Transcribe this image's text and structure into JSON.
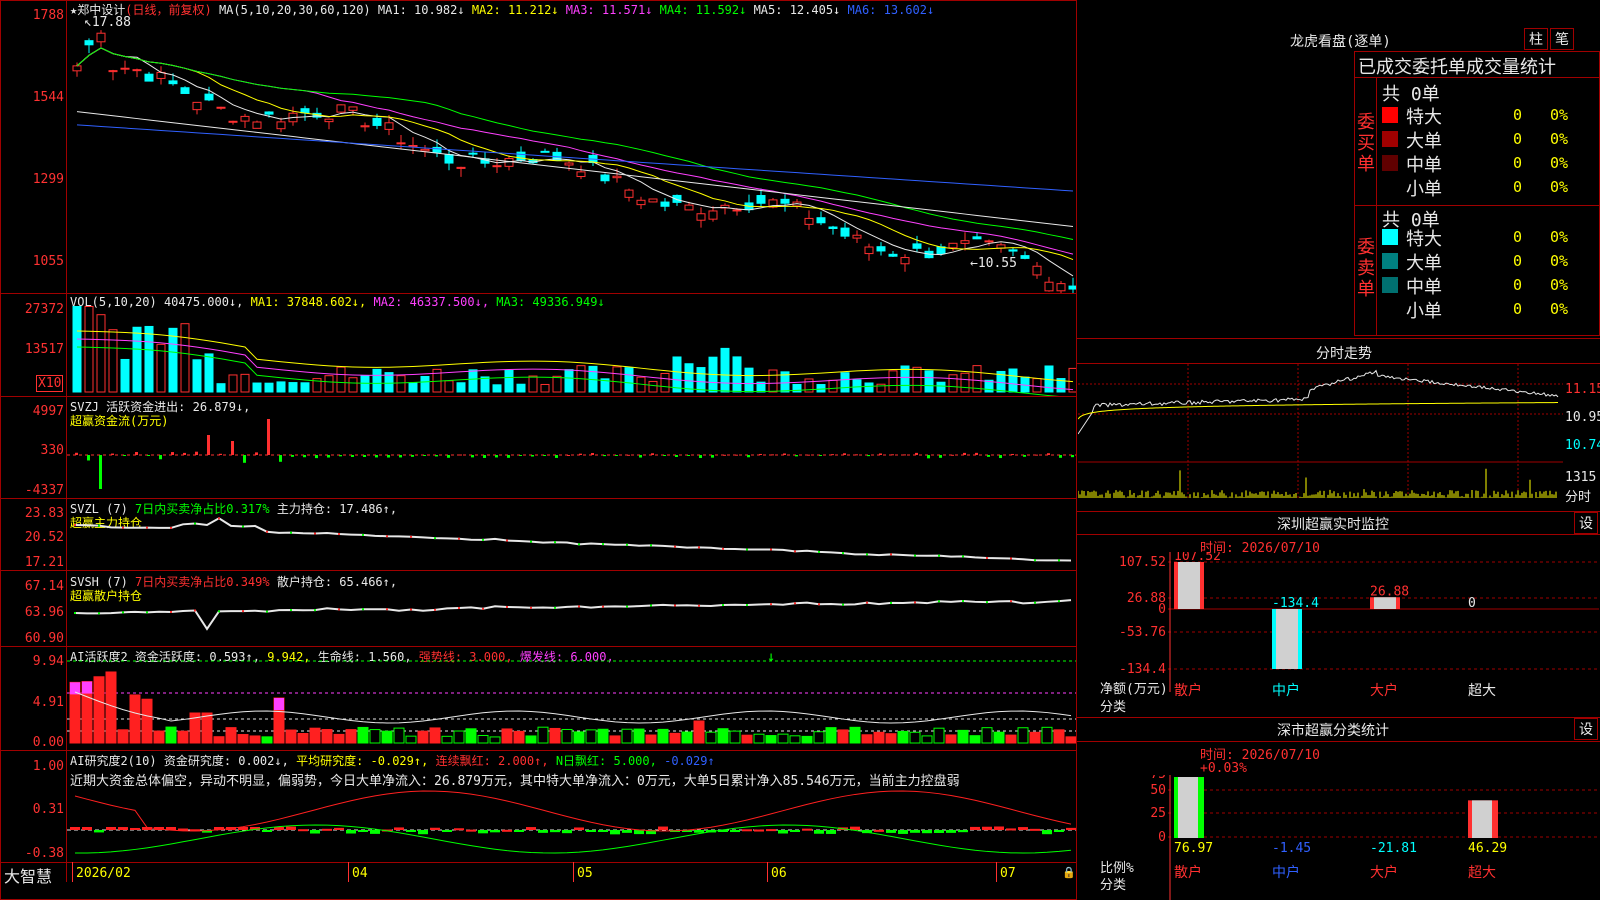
{
  "stock": {
    "name": "郑中设计",
    "mode": "(日线，前复权)",
    "ma_line": "MA(5,10,20,30,60,120)",
    "ma": [
      {
        "label": "MA1:",
        "value": "10.982↓",
        "color": "#e8e8e8"
      },
      {
        "label": "MA2:",
        "value": "11.212↓",
        "color": "#ffff00"
      },
      {
        "label": "MA3:",
        "value": "11.571↓",
        "color": "#ff40ff"
      },
      {
        "label": "MA4:",
        "value": "11.592↓",
        "color": "#00ff00"
      },
      {
        "label": "MA5:",
        "value": "12.405↓",
        "color": "#e8e8e8"
      },
      {
        "label": "MA6:",
        "value": "13.602↓",
        "color": "#3060ff"
      }
    ],
    "high_mark": "17.88",
    "low_mark": "←10.55",
    "price_ticks": [
      "1788",
      "1544",
      "1299",
      "1055"
    ]
  },
  "vol": {
    "label": "VOL(5,10,20)",
    "value": "40475.000↓,",
    "ma": [
      {
        "label": "MA1:",
        "value": "37848.602↓,",
        "color": "#ffff00"
      },
      {
        "label": "MA2:",
        "value": "46337.500↓,",
        "color": "#ff40ff"
      },
      {
        "label": "MA3:",
        "value": "49336.949↓",
        "color": "#00ff00"
      }
    ],
    "ticks": [
      "27372",
      "13517"
    ],
    "unit": "X10"
  },
  "svzj": {
    "label": "SVZJ",
    "title": "活跃资金进出:",
    "value": "26.879↓,",
    "subtitle": "超赢资金流(万元)",
    "ticks": [
      "4997",
      "330",
      "-4337"
    ]
  },
  "svzl": {
    "label": "SVZL (7)",
    "title": "7日内买卖净占比0.317%",
    "hold": "主力持仓: 17.486↑,",
    "subtitle": "超赢主力持仓",
    "ticks": [
      "23.83",
      "20.52",
      "17.21"
    ]
  },
  "svsh": {
    "label": "SVSH (7)",
    "title": "7日内买卖净占比0.349%",
    "hold": "散户持仓: 65.466↑,",
    "subtitle": "超赢散户持仓",
    "ticks": [
      "67.14",
      "63.96",
      "60.90"
    ]
  },
  "ai1": {
    "label": "AI活跃度2",
    "a": "资金活跃度: 0.593↑,",
    "b": "9.942,",
    "c": "生命线: 1.560,",
    "d": "强势线: 3.000,",
    "e": "爆发线: 6.000,",
    "ticks": [
      "9.94",
      "4.91",
      "0.00"
    ]
  },
  "ai2": {
    "label": "AI研究度2(10)",
    "a": "资金研究度: 0.002↓,",
    "b": "平均研究度: -0.029↑,",
    "c": "连续飘红: 2.000↑,",
    "d": "N日飘红: 5.000,",
    "e": "-0.029↑",
    "summary": "近期大资金总体偏空，异动不明显，偏弱势，今日大单净流入：26.879万元，其中特大单净流入：0万元，大单5日累计净入85.546万元，当前主力控盘弱",
    "ticks": [
      "1.00",
      "0.31",
      "-0.38"
    ]
  },
  "bottom": {
    "brand": "大智慧",
    "dates": [
      "2026/02",
      "04",
      "05",
      "06",
      "07"
    ]
  },
  "lhb": {
    "title": "龙虎看盘(逐单)",
    "btn1": "柱",
    "btn2": "笔",
    "header": "已成交委托单成交量统计",
    "buy_title": "委买单",
    "sell_title": "委卖单",
    "buy_total": "共 0单",
    "sell_total": "共 0单",
    "buy_rows": [
      {
        "label": "特大",
        "val": "0",
        "pct": "0%",
        "color": "#ff0000"
      },
      {
        "label": "大单",
        "val": "0",
        "pct": "0%",
        "color": "#a00000"
      },
      {
        "label": "中单",
        "val": "0",
        "pct": "0%",
        "color": "#600000"
      },
      {
        "label": "小单",
        "val": "0",
        "pct": "0%",
        "color": "#000000"
      }
    ],
    "sell_rows": [
      {
        "label": "特大",
        "val": "0",
        "pct": "0%",
        "color": "#00ffff"
      },
      {
        "label": "大单",
        "val": "0",
        "pct": "0%",
        "color": "#008080"
      },
      {
        "label": "中单",
        "val": "0",
        "pct": "0%",
        "color": "#007070"
      },
      {
        "label": "小单",
        "val": "0",
        "pct": "0%",
        "color": "#000000"
      }
    ]
  },
  "fenshi": {
    "title": "分时走势",
    "ticks": [
      "11.15",
      "10.95",
      "10.74"
    ],
    "vol_tick": "1315",
    "vol_unit": "分时"
  },
  "monitor": {
    "title": "深圳超赢实时监控",
    "btn": "设",
    "time": "时间: 2026/07/10",
    "ticks": [
      "107.52",
      "26.88",
      "0",
      "-53.76",
      "-134.4"
    ],
    "unit": "净额(万元)",
    "cat_label": "分类",
    "bars": [
      {
        "cat": "散户",
        "value": "107.52"
      },
      {
        "cat": "中户",
        "value": "-134.4"
      },
      {
        "cat": "大户",
        "value": "26.88"
      },
      {
        "cat": "超大",
        "value": "0"
      }
    ]
  },
  "classify": {
    "title": "深市超赢分类统计",
    "btn": "设",
    "time": "时间: 2026/07/10",
    "top": "+0.03%",
    "ticks": [
      "75",
      "50",
      "25",
      "0"
    ],
    "unit": "比例%",
    "cat_label": "分类",
    "bars": [
      {
        "cat": "散户",
        "value": "76.97"
      },
      {
        "cat": "中户",
        "value": "-1.45"
      },
      {
        "cat": "大户",
        "value": "-21.81"
      },
      {
        "cat": "超大",
        "value": "46.29"
      }
    ]
  }
}
